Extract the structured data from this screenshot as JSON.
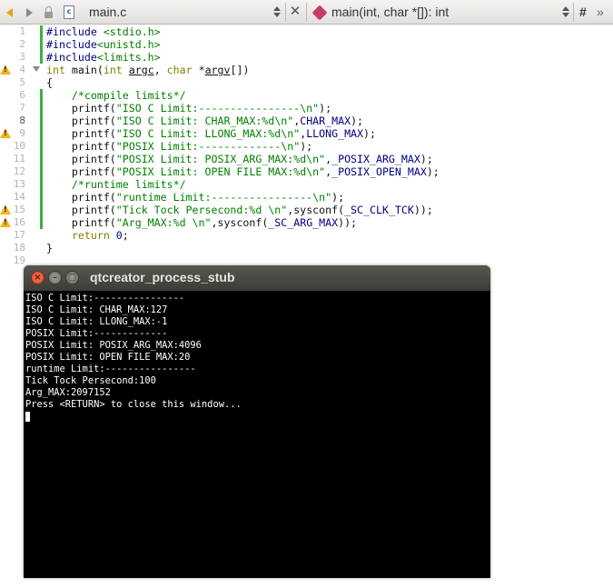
{
  "toolbar": {
    "file_combo": "main.c",
    "file_icon_letter": "c",
    "symbol_combo": "main(int, char *[]): int",
    "hash_label": "#",
    "overflow_label": "»"
  },
  "editor": {
    "lines": [
      {
        "n": "1",
        "marker": "none",
        "changed": true,
        "fold": false,
        "tokens": [
          {
            "t": "#include ",
            "c": "pp"
          },
          {
            "t": "<stdio.h>",
            "c": "inc"
          }
        ]
      },
      {
        "n": "2",
        "marker": "none",
        "changed": true,
        "fold": false,
        "tokens": [
          {
            "t": "#include",
            "c": "pp"
          },
          {
            "t": "<unistd.h>",
            "c": "inc"
          }
        ]
      },
      {
        "n": "3",
        "marker": "none",
        "changed": true,
        "fold": false,
        "tokens": [
          {
            "t": "#include",
            "c": "pp"
          },
          {
            "t": "<limits.h>",
            "c": "inc"
          }
        ]
      },
      {
        "n": "4",
        "marker": "warning",
        "changed": false,
        "fold": true,
        "tokens": [
          {
            "t": "int",
            "c": "kw"
          },
          {
            "t": " main(",
            "c": ""
          },
          {
            "t": "int",
            "c": "kw"
          },
          {
            "t": " ",
            "c": ""
          },
          {
            "t": "argc",
            "c": "ul"
          },
          {
            "t": ", ",
            "c": ""
          },
          {
            "t": "char",
            "c": "kw"
          },
          {
            "t": " *",
            "c": ""
          },
          {
            "t": "argv",
            "c": "ul"
          },
          {
            "t": "[])",
            "c": ""
          }
        ]
      },
      {
        "n": "5",
        "marker": "none",
        "changed": false,
        "fold": false,
        "tokens": [
          {
            "t": "{",
            "c": ""
          }
        ]
      },
      {
        "n": "6",
        "marker": "none",
        "changed": true,
        "fold": false,
        "tokens": [
          {
            "t": "    /*compile limits*/",
            "c": "cm"
          }
        ]
      },
      {
        "n": "7",
        "marker": "none",
        "changed": true,
        "fold": false,
        "tokens": [
          {
            "t": "    printf(",
            "c": ""
          },
          {
            "t": "\"ISO C Limit:----------------\\n\"",
            "c": "str"
          },
          {
            "t": ");",
            "c": ""
          }
        ]
      },
      {
        "n": "8",
        "marker": "none",
        "changed": true,
        "fold": false,
        "current": true,
        "tokens": [
          {
            "t": "    printf(",
            "c": ""
          },
          {
            "t": "\"ISO C Limit: CHAR_MAX:%d\\n\"",
            "c": "str"
          },
          {
            "t": ",",
            "c": ""
          },
          {
            "t": "CHAR_MAX",
            "c": "mac"
          },
          {
            "t": ");",
            "c": ""
          }
        ]
      },
      {
        "n": "9",
        "marker": "warning",
        "changed": true,
        "fold": false,
        "tokens": [
          {
            "t": "    printf(",
            "c": ""
          },
          {
            "t": "\"ISO C Limit: LLONG_MAX:%d\\n\"",
            "c": "str"
          },
          {
            "t": ",",
            "c": ""
          },
          {
            "t": "LLONG_MAX",
            "c": "mac"
          },
          {
            "t": ");",
            "c": ""
          }
        ]
      },
      {
        "n": "10",
        "marker": "none",
        "changed": true,
        "fold": false,
        "tokens": [
          {
            "t": "    printf(",
            "c": ""
          },
          {
            "t": "\"POSIX Limit:-------------\\n\"",
            "c": "str"
          },
          {
            "t": ");",
            "c": ""
          }
        ]
      },
      {
        "n": "11",
        "marker": "none",
        "changed": true,
        "fold": false,
        "tokens": [
          {
            "t": "    printf(",
            "c": ""
          },
          {
            "t": "\"POSIX Limit: POSIX_ARG_MAX:%d\\n\"",
            "c": "str"
          },
          {
            "t": ",",
            "c": ""
          },
          {
            "t": "_POSIX_ARG_MAX",
            "c": "mac"
          },
          {
            "t": ");",
            "c": ""
          }
        ]
      },
      {
        "n": "12",
        "marker": "none",
        "changed": true,
        "fold": false,
        "tokens": [
          {
            "t": "    printf(",
            "c": ""
          },
          {
            "t": "\"POSIX Limit: OPEN FILE MAX:%d\\n\"",
            "c": "str"
          },
          {
            "t": ",",
            "c": ""
          },
          {
            "t": "_POSIX_OPEN_MAX",
            "c": "mac"
          },
          {
            "t": ");",
            "c": ""
          }
        ]
      },
      {
        "n": "13",
        "marker": "none",
        "changed": true,
        "fold": false,
        "tokens": [
          {
            "t": "    /*runtime limits*/",
            "c": "cm"
          }
        ]
      },
      {
        "n": "14",
        "marker": "none",
        "changed": true,
        "fold": false,
        "tokens": [
          {
            "t": "    printf(",
            "c": ""
          },
          {
            "t": "\"runtime Limit:----------------\\n\"",
            "c": "str"
          },
          {
            "t": ");",
            "c": ""
          }
        ]
      },
      {
        "n": "15",
        "marker": "warning",
        "changed": true,
        "fold": false,
        "tokens": [
          {
            "t": "    printf(",
            "c": ""
          },
          {
            "t": "\"Tick Tock Persecond:%d \\n\"",
            "c": "str"
          },
          {
            "t": ",sysconf(",
            "c": ""
          },
          {
            "t": "_SC_CLK_TCK",
            "c": "mac"
          },
          {
            "t": "));",
            "c": ""
          }
        ]
      },
      {
        "n": "16",
        "marker": "warning",
        "changed": true,
        "fold": false,
        "tokens": [
          {
            "t": "    printf(",
            "c": ""
          },
          {
            "t": "\"Arg_MAX:%d \\n\"",
            "c": "str"
          },
          {
            "t": ",sysconf(",
            "c": ""
          },
          {
            "t": "_SC_ARG_MAX",
            "c": "mac"
          },
          {
            "t": "));",
            "c": ""
          }
        ]
      },
      {
        "n": "17",
        "marker": "none",
        "changed": false,
        "fold": false,
        "tokens": [
          {
            "t": "    ",
            "c": ""
          },
          {
            "t": "return",
            "c": "kw"
          },
          {
            "t": " ",
            "c": ""
          },
          {
            "t": "0",
            "c": "num"
          },
          {
            "t": ";",
            "c": ""
          }
        ]
      },
      {
        "n": "18",
        "marker": "none",
        "changed": false,
        "fold": false,
        "tokens": [
          {
            "t": "}",
            "c": ""
          }
        ]
      },
      {
        "n": "19",
        "marker": "none",
        "changed": false,
        "fold": false,
        "tokens": []
      }
    ]
  },
  "terminal": {
    "title": "qtcreator_process_stub",
    "close_glyph": "×",
    "min_glyph": "–",
    "max_glyph": "□",
    "output": [
      "ISO C Limit:----------------",
      "ISO C Limit: CHAR_MAX:127",
      "ISO C Limit: LLONG_MAX:-1",
      "POSIX Limit:-------------",
      "POSIX Limit: POSIX_ARG_MAX:4096",
      "POSIX Limit: OPEN FILE MAX:20",
      "runtime Limit:----------------",
      "Tick Tock Persecond:100",
      "Arg_MAX:2097152",
      "Press <RETURN> to close this window..."
    ]
  }
}
